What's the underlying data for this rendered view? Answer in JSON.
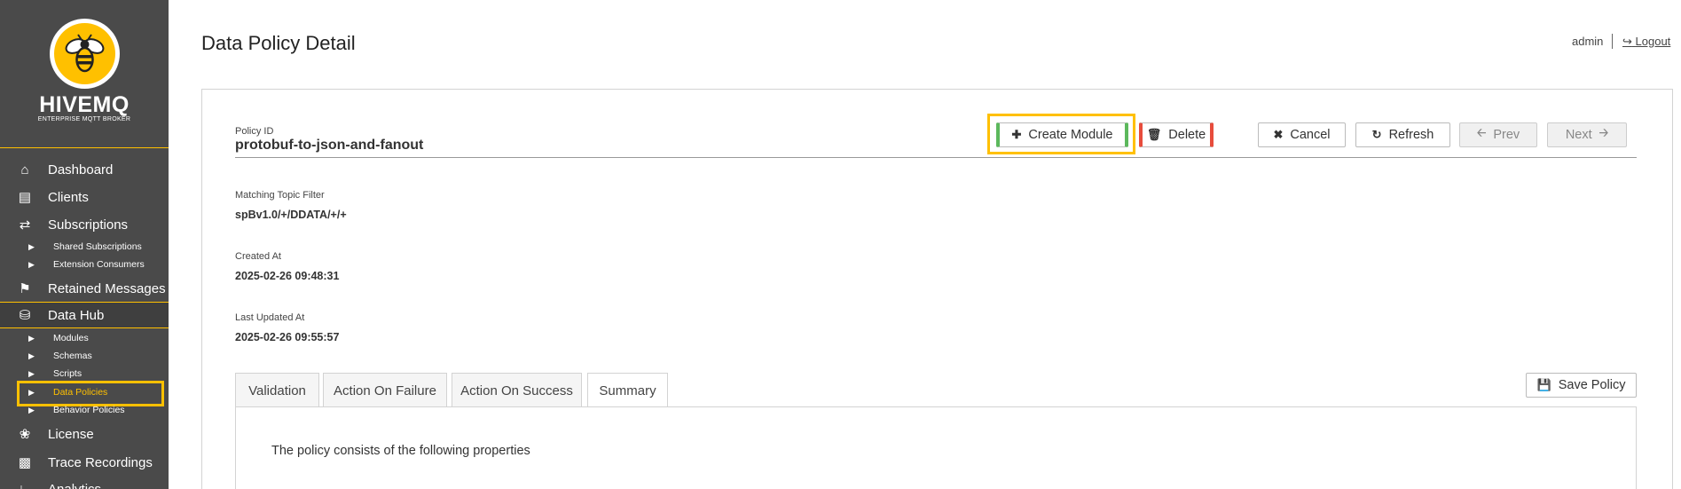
{
  "sidebar": {
    "brand": "HIVEMQ",
    "brand_sub": "ENTERPRISE MQTT BROKER",
    "items": [
      {
        "label": "Dashboard",
        "icon": "home-icon"
      },
      {
        "label": "Clients",
        "icon": "laptop-icon"
      },
      {
        "label": "Subscriptions",
        "icon": "shuffle-icon"
      },
      {
        "label": "Retained Messages",
        "icon": "flag-icon"
      },
      {
        "label": "Data Hub",
        "icon": "database-icon"
      },
      {
        "label": "License",
        "icon": "certificate-icon"
      },
      {
        "label": "Trace Recordings",
        "icon": "trace-icon"
      },
      {
        "label": "Analytics",
        "icon": "chart-icon"
      }
    ],
    "subscriptions_sub": [
      "Shared Subscriptions",
      "Extension Consumers"
    ],
    "datahub_sub": [
      "Modules",
      "Schemas",
      "Scripts",
      "Data Policies",
      "Behavior Policies"
    ],
    "accent": "#ffc000"
  },
  "header": {
    "title": "Data Policy Detail",
    "user": "admin",
    "logout": "Logout"
  },
  "policy": {
    "id_label": "Policy ID",
    "id": "protobuf-to-json-and-fanout",
    "topic_label": "Matching Topic Filter",
    "topic": "spBv1.0/+/DDATA/+/+",
    "created_label": "Created At",
    "created": "2025-02-26 09:48:31",
    "updated_label": "Last Updated At",
    "updated": "2025-02-26 09:55:57"
  },
  "toolbar": {
    "create_module": "Create Module",
    "delete": "Delete",
    "cancel": "Cancel",
    "refresh": "Refresh",
    "prev": "Prev",
    "next": "Next",
    "save_policy": "Save Policy"
  },
  "tabs": [
    "Validation",
    "Action On Failure",
    "Action On Success",
    "Summary"
  ],
  "active_tab": "Summary",
  "summary": {
    "text": "The policy consists of the following properties"
  }
}
